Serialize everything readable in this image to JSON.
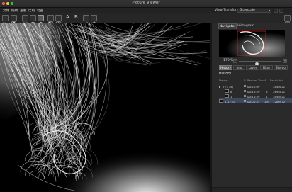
{
  "window": {
    "title": "Picture Viewer",
    "traffic_colors": [
      "#ff5f57",
      "#febc2e",
      "#28c840"
    ]
  },
  "menubar": {
    "items": [
      "文件",
      "编辑",
      "查看",
      "比较",
      "动画"
    ],
    "view_transform_label": "View Transform:",
    "view_transform_value": "Grayscale"
  },
  "toolbar": {
    "text_a": "A",
    "text_b": "B"
  },
  "panel": {
    "tabs": [
      "Navigator",
      "Histogram"
    ],
    "zoom_value": "179 %",
    "zoom_level_fraction": 0.42,
    "zoom_minus": "−",
    "zoom_plus": "+",
    "mode_tabs": [
      "History",
      "Info",
      "Layer",
      "Filter",
      "Stereo"
    ],
    "history_title": "History",
    "history_columns": [
      "Name",
      "R",
      "Render Time",
      "F",
      "Resolutio"
    ],
    "history_rows": [
      {
        "name": "T+7 (5)",
        "r": "",
        "time": "00:21:09",
        "f": "",
        "res": "3840x21"
      },
      {
        "name": "8",
        "r": "",
        "time": "00:10:59",
        "f": "6",
        "res": "2694x21"
      },
      {
        "name": "1",
        "r": "",
        "time": "00:10:59",
        "f": "1",
        "res": "3840x21"
      },
      {
        "name": "1.4 (10)",
        "r": "",
        "time": "00:01:33",
        "f": "134",
        "res": "1280x72"
      }
    ]
  },
  "colors": {
    "accent_selection": "#3d4a5d",
    "canvas_bg": "#000000"
  }
}
